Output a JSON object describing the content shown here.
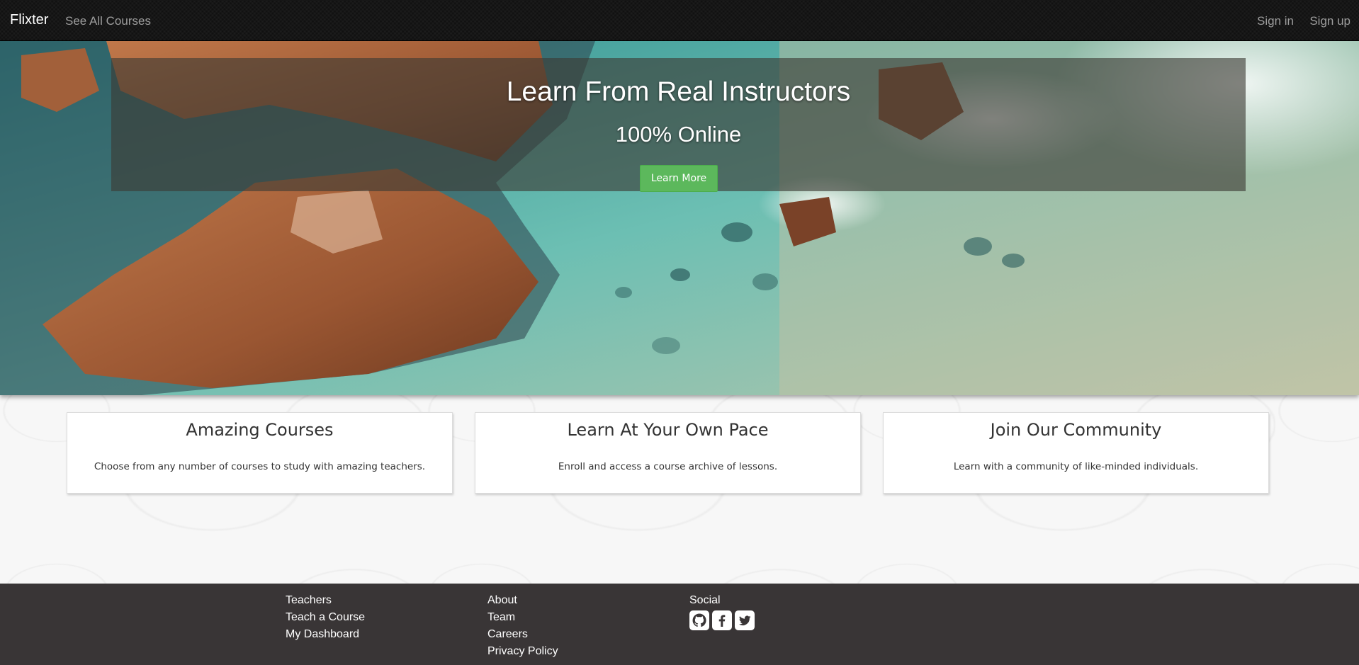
{
  "navbar": {
    "brand": "Flixter",
    "links_left": [
      "See All Courses"
    ],
    "sign_in": "Sign in",
    "sign_up": "Sign up"
  },
  "hero": {
    "title": "Learn From Real Instructors",
    "subtitle": "100% Online",
    "button": "Learn More"
  },
  "features": [
    {
      "title": "Amazing Courses",
      "text": "Choose from any number of courses to study with amazing teachers."
    },
    {
      "title": "Learn At Your Own Pace",
      "text": "Enroll and access a course archive of lessons."
    },
    {
      "title": "Join Our Community",
      "text": "Learn with a community of like-minded individuals."
    }
  ],
  "footer": {
    "col1": [
      "Teachers",
      "Teach a Course",
      "My Dashboard"
    ],
    "col2": [
      "About",
      "Team",
      "Careers",
      "Privacy Policy"
    ],
    "social_heading": "Social",
    "social_icons": [
      "github-icon",
      "facebook-icon",
      "twitter-icon"
    ]
  },
  "colors": {
    "navbar_bg": "#111111",
    "button_green": "#5cb85c",
    "footer_bg": "#393536"
  }
}
